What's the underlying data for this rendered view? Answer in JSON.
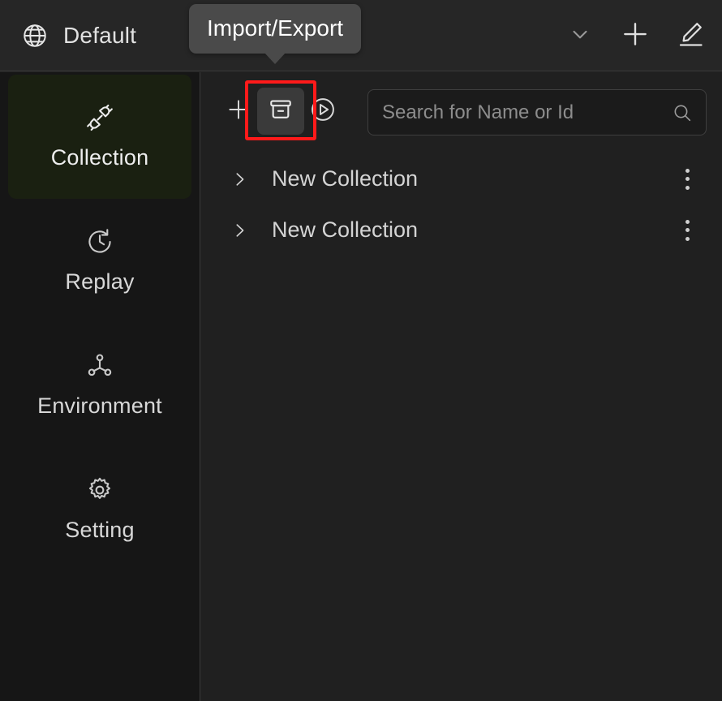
{
  "header": {
    "workspace_icon": "globe-icon",
    "workspace_name": "Default",
    "actions": [
      {
        "name": "chevron-down-icon",
        "label": "Collapse"
      },
      {
        "name": "plus-icon",
        "label": "Add"
      },
      {
        "name": "edit-pencil-icon",
        "label": "Edit"
      }
    ]
  },
  "tooltip": {
    "text": "Import/Export",
    "bg": "#4a4a4a"
  },
  "sidebar": {
    "items": [
      {
        "label": "Collection",
        "icon": "plug-connector-icon",
        "active": true
      },
      {
        "label": "Replay",
        "icon": "clock-history-icon",
        "active": false
      },
      {
        "label": "Environment",
        "icon": "node-network-icon",
        "active": false
      },
      {
        "label": "Setting",
        "icon": "gear-icon",
        "active": false
      }
    ],
    "active_bg": "#1a2011"
  },
  "toolbar": {
    "add_label": "Add",
    "import_export_label": "Import/Export",
    "run_label": "Run",
    "highlight_color": "#ff1a1a"
  },
  "search": {
    "placeholder": "Search for Name or Id",
    "value": ""
  },
  "collections": [
    {
      "name": "New Collection",
      "expanded": false
    },
    {
      "name": "New Collection",
      "expanded": false
    }
  ],
  "colors": {
    "window_bg": "#202020",
    "header_bg": "#262626",
    "sidebar_bg": "#161616",
    "border": "#3a3a3a",
    "text": "#d4d4d4",
    "placeholder": "#8d8d8d"
  }
}
